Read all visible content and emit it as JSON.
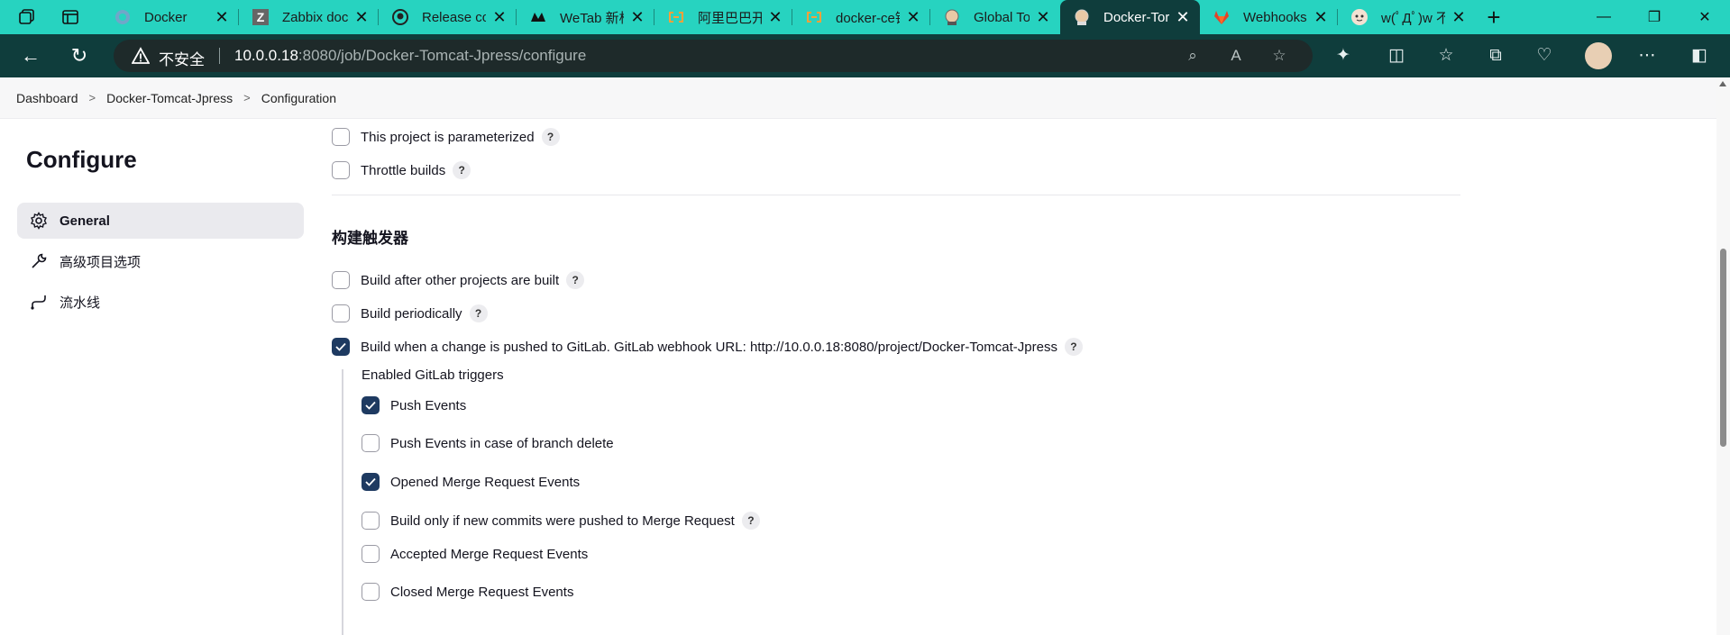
{
  "tabs": [
    {
      "label": "Docker",
      "icon": "docker-icon"
    },
    {
      "label": "Zabbix doc",
      "icon": "zabbix-icon"
    },
    {
      "label": "Release cor",
      "icon": "github-icon"
    },
    {
      "label": "WeTab 新标",
      "icon": "wetab-icon"
    },
    {
      "label": "阿里巴巴开",
      "icon": "aliyun-icon"
    },
    {
      "label": "docker-ce镜",
      "icon": "aliyun-icon"
    },
    {
      "label": "Global Tool",
      "icon": "jenkins-icon"
    },
    {
      "label": "Docker-Tor",
      "icon": "jenkins-icon"
    },
    {
      "label": "Webhooks",
      "icon": "gitlab-icon"
    },
    {
      "label": "w(ﾟДﾟ)w 不",
      "icon": "avatar-icon"
    }
  ],
  "active_tab_index": 7,
  "address": {
    "security_label": "不安全",
    "url_host": "10.0.0.18",
    "url_rest": ":8080/job/Docker-Tomcat-Jpress/configure"
  },
  "breadcrumb": [
    "Dashboard",
    "Docker-Tomcat-Jpress",
    "Configuration"
  ],
  "sidebar": {
    "title": "Configure",
    "items": [
      {
        "label": "General",
        "icon": "gear-icon",
        "active": true
      },
      {
        "label": "高级项目选项",
        "icon": "wrench-icon",
        "active": false
      },
      {
        "label": "流水线",
        "icon": "pipeline-icon",
        "active": false
      }
    ]
  },
  "general_options": [
    {
      "label": "This project is parameterized",
      "checked": false
    },
    {
      "label": "Throttle builds",
      "checked": false
    }
  ],
  "triggers": {
    "heading": "构建触发器",
    "items": [
      {
        "label": "Build after other projects are built",
        "checked": false
      },
      {
        "label": "Build periodically",
        "checked": false
      },
      {
        "label": "Build when a change is pushed to GitLab. GitLab webhook URL: http://10.0.0.18:8080/project/Docker-Tomcat-Jpress",
        "checked": true
      }
    ],
    "gitlab": {
      "label": "Enabled GitLab triggers",
      "items": [
        {
          "label": "Push Events",
          "checked": true,
          "help": false
        },
        {
          "label": "Push Events in case of branch delete",
          "checked": false,
          "help": false
        },
        {
          "label": "Opened Merge Request Events",
          "checked": true,
          "help": false
        },
        {
          "label": "Build only if new commits were pushed to Merge Request",
          "checked": false,
          "help": true
        },
        {
          "label": "Accepted Merge Request Events",
          "checked": false,
          "help": false
        },
        {
          "label": "Closed Merge Request Events",
          "checked": false,
          "help": false
        }
      ]
    }
  },
  "help_glyph": "?",
  "colors": {
    "tabbar": "#27d3c0",
    "toolbar": "#0f3d3c",
    "checked": "#1e3a61"
  }
}
